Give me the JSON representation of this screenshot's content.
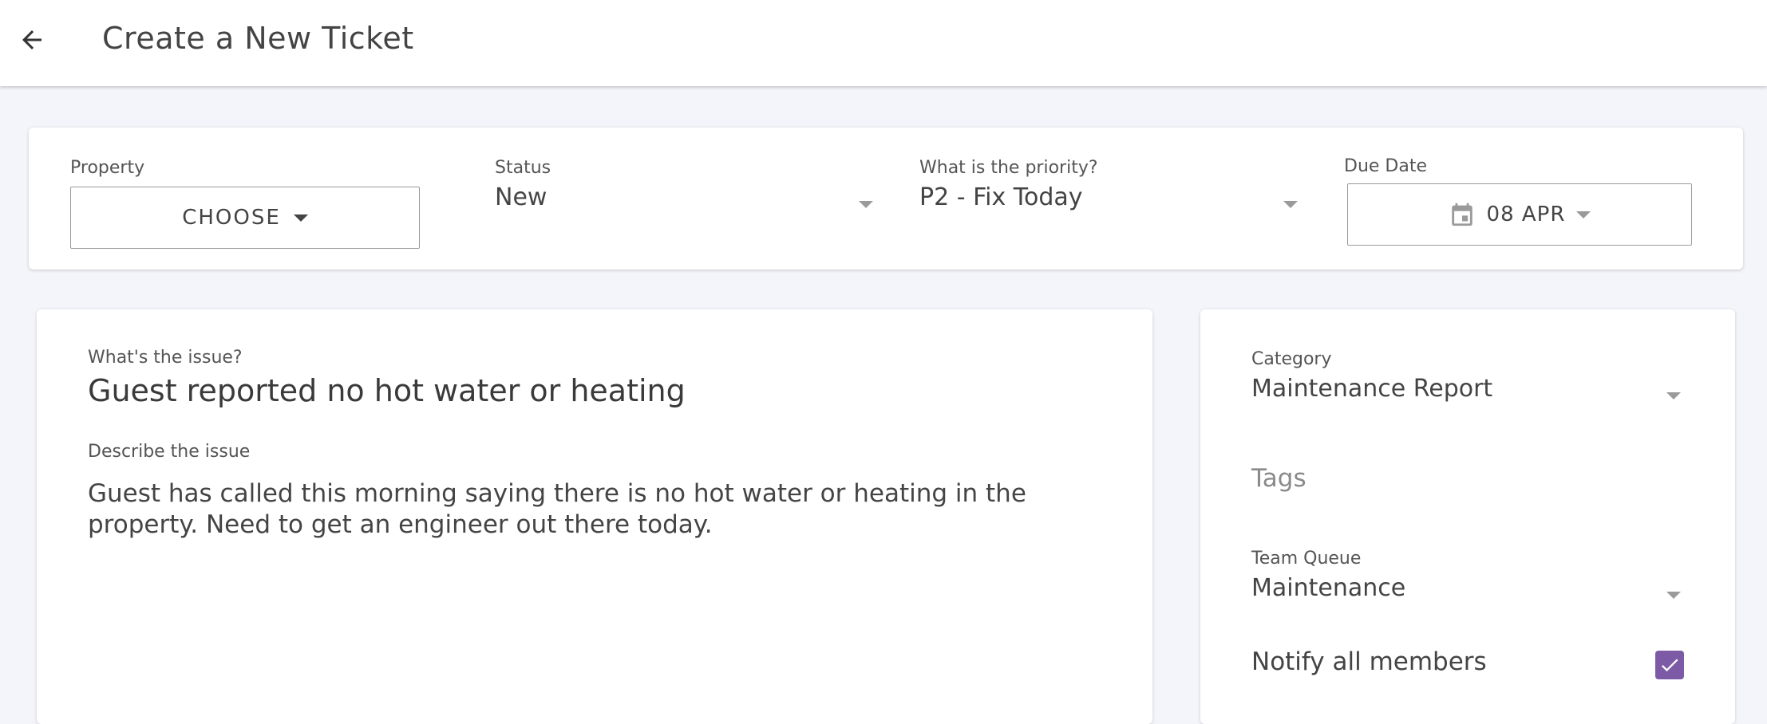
{
  "header": {
    "title": "Create a New Ticket",
    "back_icon": "arrow-left-icon"
  },
  "top": {
    "property": {
      "label": "Property",
      "value": "CHOOSE"
    },
    "status": {
      "label": "Status",
      "value": "New"
    },
    "priority": {
      "label": "What is the priority?",
      "value": "P2 - Fix Today"
    },
    "due_date": {
      "label": "Due Date",
      "value": "08 APR",
      "icon": "calendar-icon"
    }
  },
  "issue": {
    "title_label": "What's the issue?",
    "title_value": "Guest reported no hot water or heating",
    "desc_label": "Describe the issue",
    "desc_value": "Guest has called this morning saying there is no hot water or heating in the property. Need to get an engineer out there today."
  },
  "side": {
    "category": {
      "label": "Category",
      "value": "Maintenance Report"
    },
    "tags": {
      "placeholder": "Tags"
    },
    "team_queue": {
      "label": "Team Queue",
      "value": "Maintenance"
    },
    "notify": {
      "label": "Notify all members",
      "checked": true
    }
  },
  "colors": {
    "accent": "#7c5aa6",
    "background": "#f4f5fa"
  }
}
